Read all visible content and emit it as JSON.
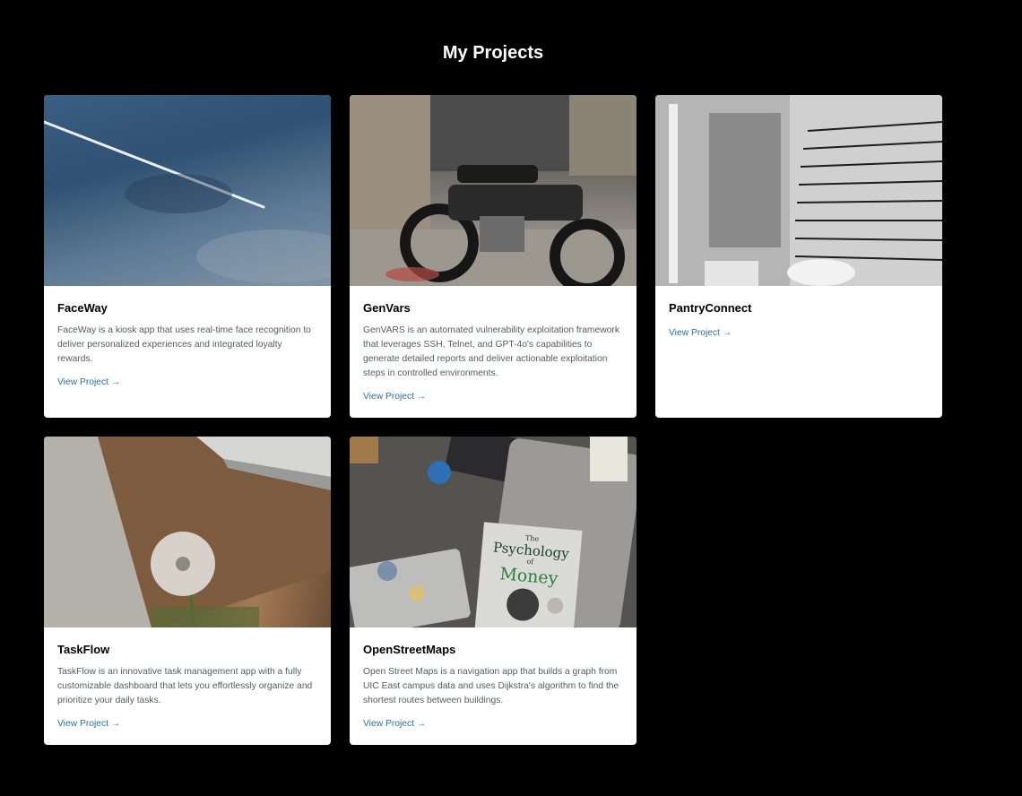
{
  "page": {
    "title": "My Projects"
  },
  "projects": [
    {
      "title": "FaceWay",
      "description": "FaceWay is a kiosk app that uses real-time face recognition to deliver personalized experiences and integrated loyalty rewards.",
      "link_label": "View Project →"
    },
    {
      "title": "GenVars",
      "description": "GenVARS is an automated vulnerability exploitation framework that leverages SSH, Telnet, and GPT-4o's capabilities to generate detailed reports and deliver actionable exploitation steps in controlled environments.",
      "link_label": "View Project →"
    },
    {
      "title": "PantryConnect",
      "description": "",
      "link_label": "View Project →"
    },
    {
      "title": "TaskFlow",
      "description": "TaskFlow is an innovative task management app with a fully customizable dashboard that lets you effortlessly organize and prioritize your daily tasks.",
      "link_label": "View Project →"
    },
    {
      "title": "OpenStreetMaps",
      "description": "Open Street Maps is a navigation app that builds a graph from UIC East campus data and uses Dijkstra's algorithm to find the shortest routes between buildings.",
      "link_label": "View Project →"
    }
  ],
  "images": {
    "project_0": "sky-with-contrail",
    "project_1": "motorcycle-parked",
    "project_2": "black-and-white-stacked-boxes",
    "project_3": "dandelion-by-wall",
    "project_4": "desk-with-book-and-tablet"
  },
  "book_cover": {
    "line1": "The",
    "line2": "Psychology",
    "line3": "of",
    "line4": "Money"
  },
  "colors": {
    "background": "#000000",
    "card": "#ffffff",
    "link": "#2a6f9c"
  }
}
